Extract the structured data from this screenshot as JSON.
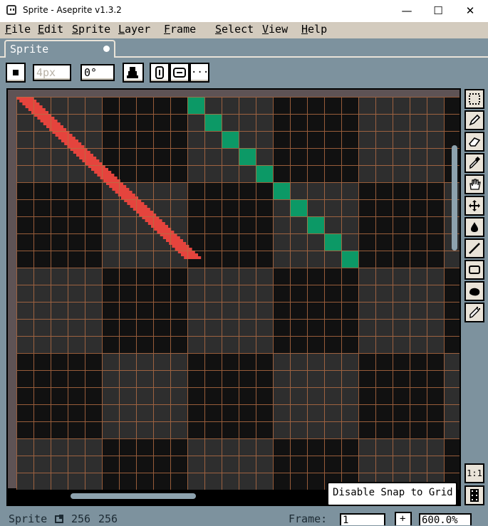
{
  "window": {
    "title": "Sprite - Aseprite v1.3.2",
    "minimize_glyph": "—",
    "maximize_glyph": "☐",
    "close_glyph": "✕"
  },
  "menu": [
    "File",
    "Edit",
    "Sprite",
    "Layer",
    "Frame",
    "Select",
    "View",
    "Help"
  ],
  "tabs": [
    {
      "label": "Sprite",
      "modified": true
    }
  ],
  "context_bar": {
    "brush_size": "4px",
    "brush_angle": "0°",
    "more_glyph": "···"
  },
  "canvas": {
    "sprite_width": 256,
    "sprite_height": 256,
    "checker_dark": "#111111",
    "checker_light": "#2e2e2e",
    "grid_color": "#b96f45",
    "stroke_red": "#e5443d",
    "stroke_green": "#0c9966"
  },
  "tools": [
    {
      "name": "rectangular-marquee-icon"
    },
    {
      "name": "pencil-icon"
    },
    {
      "name": "eraser-icon"
    },
    {
      "name": "eyedropper-icon"
    },
    {
      "name": "hand-icon"
    },
    {
      "name": "move-icon"
    },
    {
      "name": "paint-bucket-icon"
    },
    {
      "name": "line-icon"
    },
    {
      "name": "rectangle-icon"
    },
    {
      "name": "contour-icon"
    },
    {
      "name": "blur-icon"
    }
  ],
  "snap_button": {
    "label": "Disable Snap to Grid"
  },
  "zoom_reset": {
    "label": "1:1"
  },
  "status": {
    "sprite_name": "Sprite",
    "size_w": "256",
    "size_h": "256",
    "frame_label": "Frame:",
    "frame_value": "1",
    "add_frame": "+",
    "zoom_value": "600.0%"
  }
}
